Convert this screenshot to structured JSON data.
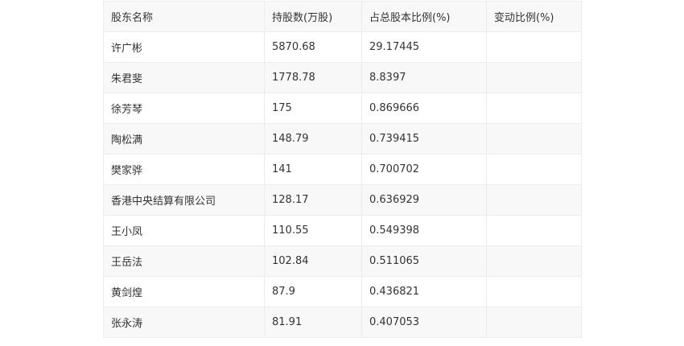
{
  "table": {
    "headers": [
      "股东名称",
      "持股数(万股)",
      "占总股本比例(%)",
      "变动比例(%)"
    ],
    "rows": [
      [
        "许广彬",
        "5870.68",
        "29.17445",
        ""
      ],
      [
        "朱君斐",
        "1778.78",
        "8.8397",
        ""
      ],
      [
        "徐芳琴",
        "175",
        "0.869666",
        ""
      ],
      [
        "陶松满",
        "148.79",
        "0.739415",
        ""
      ],
      [
        "樊家骅",
        "141",
        "0.700702",
        ""
      ],
      [
        "香港中央结算有限公司",
        "128.17",
        "0.636929",
        ""
      ],
      [
        "王小凤",
        "110.55",
        "0.549398",
        ""
      ],
      [
        "王岳法",
        "102.84",
        "0.511065",
        ""
      ],
      [
        "黄剑煌",
        "87.9",
        "0.436821",
        ""
      ],
      [
        "张永涛",
        "81.91",
        "0.407053",
        ""
      ]
    ]
  }
}
